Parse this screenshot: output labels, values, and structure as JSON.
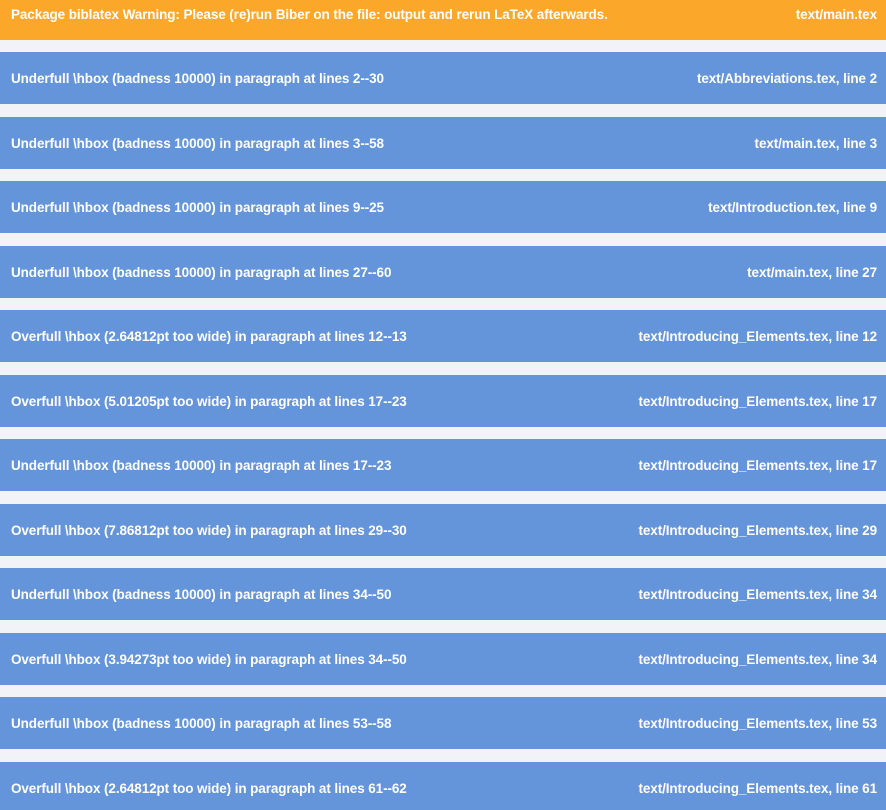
{
  "colors": {
    "warning": "#fba82a",
    "badbox": "#6494d9",
    "separator": "#f2f3f7",
    "text": "#ffffff"
  },
  "entries": [
    {
      "type": "warning",
      "message": "Package biblatex Warning: Please (re)run Biber on the file: output and rerun LaTeX afterwards.",
      "location": "text/main.tex"
    },
    {
      "type": "badbox",
      "message": "Underfull \\hbox (badness 10000) in paragraph at lines 2--30",
      "location": "text/Abbreviations.tex, line 2"
    },
    {
      "type": "badbox",
      "message": "Underfull \\hbox (badness 10000) in paragraph at lines 3--58",
      "location": "text/main.tex, line 3"
    },
    {
      "type": "badbox",
      "message": "Underfull \\hbox (badness 10000) in paragraph at lines 9--25",
      "location": "text/Introduction.tex, line 9"
    },
    {
      "type": "badbox",
      "message": "Underfull \\hbox (badness 10000) in paragraph at lines 27--60",
      "location": "text/main.tex, line 27"
    },
    {
      "type": "badbox",
      "message": "Overfull \\hbox (2.64812pt too wide) in paragraph at lines 12--13",
      "location": "text/Introducing_Elements.tex, line 12"
    },
    {
      "type": "badbox",
      "message": "Overfull \\hbox (5.01205pt too wide) in paragraph at lines 17--23",
      "location": "text/Introducing_Elements.tex, line 17"
    },
    {
      "type": "badbox",
      "message": "Underfull \\hbox (badness 10000) in paragraph at lines 17--23",
      "location": "text/Introducing_Elements.tex, line 17"
    },
    {
      "type": "badbox",
      "message": "Overfull \\hbox (7.86812pt too wide) in paragraph at lines 29--30",
      "location": "text/Introducing_Elements.tex, line 29"
    },
    {
      "type": "badbox",
      "message": "Underfull \\hbox (badness 10000) in paragraph at lines 34--50",
      "location": "text/Introducing_Elements.tex, line 34"
    },
    {
      "type": "badbox",
      "message": "Overfull \\hbox (3.94273pt too wide) in paragraph at lines 34--50",
      "location": "text/Introducing_Elements.tex, line 34"
    },
    {
      "type": "badbox",
      "message": "Underfull \\hbox (badness 10000) in paragraph at lines 53--58",
      "location": "text/Introducing_Elements.tex, line 53"
    },
    {
      "type": "badbox",
      "message": "Overfull \\hbox (2.64812pt too wide) in paragraph at lines 61--62",
      "location": "text/Introducing_Elements.tex, line 61"
    }
  ]
}
